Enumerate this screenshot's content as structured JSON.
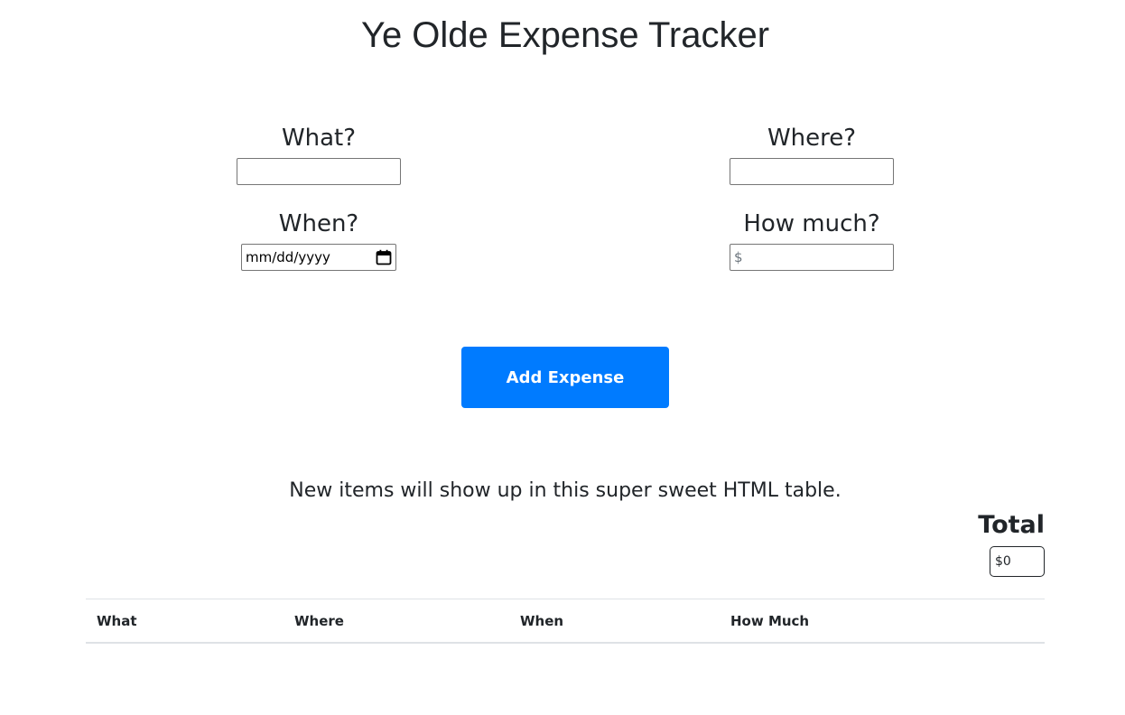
{
  "header": {
    "title": "Ye Olde Expense Tracker"
  },
  "form": {
    "what": {
      "label": "What?",
      "value": "",
      "placeholder": ""
    },
    "where": {
      "label": "Where?",
      "value": "",
      "placeholder": ""
    },
    "when": {
      "label": "When?",
      "placeholder": "mm/dd/yyyy",
      "icon": "calendar-icon"
    },
    "how_much": {
      "label": "How much?",
      "value": "",
      "placeholder": "$"
    },
    "submit_label": "Add Expense"
  },
  "info_text": "New items will show up in this super sweet HTML table.",
  "total": {
    "label": "Total",
    "value": "$0"
  },
  "table": {
    "columns": [
      "What",
      "Where",
      "When",
      "How Much"
    ],
    "rows": []
  },
  "colors": {
    "accent": "#007bff",
    "text": "#212529",
    "border": "#dee2e6"
  }
}
